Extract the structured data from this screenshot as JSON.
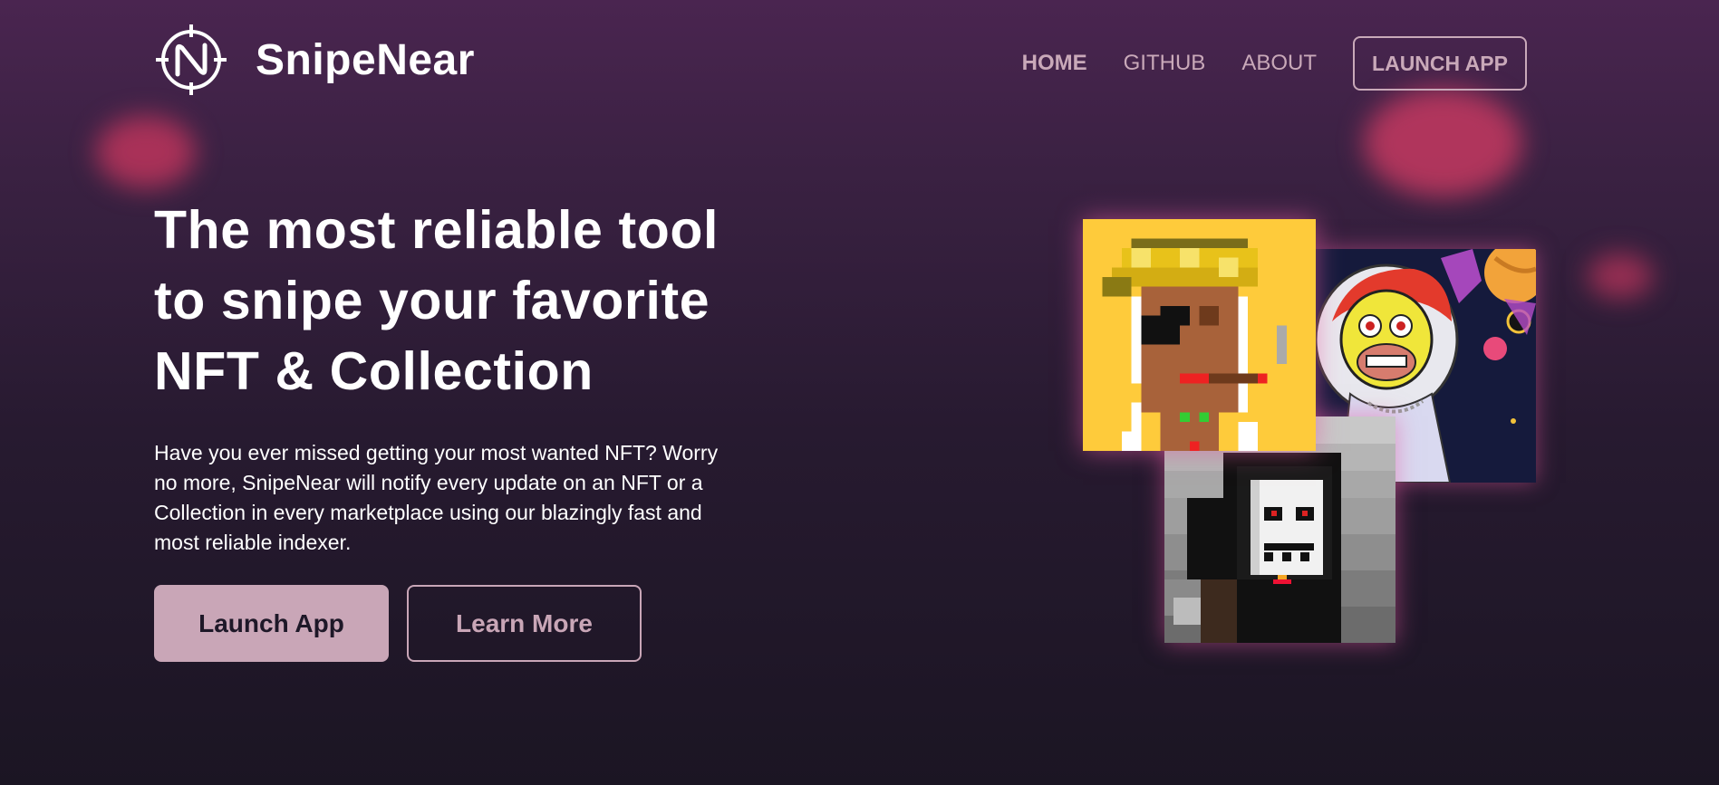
{
  "brand": {
    "name": "SnipeNear",
    "logo_icon": "n-crosshair-logo-icon"
  },
  "nav": {
    "items": [
      {
        "label": "HOME",
        "active": true
      },
      {
        "label": "GITHUB",
        "active": false
      },
      {
        "label": "ABOUT",
        "active": false
      }
    ],
    "cta_label": "LAUNCH APP"
  },
  "hero": {
    "title_lines": [
      "The most reliable tool",
      "to snipe your favorite",
      "NFT & Collection"
    ],
    "description": "Have you ever missed getting your most wanted NFT? Worry no more, SnipeNear will notify every update on an NFT or a Collection in every marketplace using our blazingly fast and most reliable indexer.",
    "primary_button": "Launch App",
    "secondary_button": "Learn More"
  },
  "nft_images": [
    {
      "name": "pixel-punk-nft",
      "background": "#fecb3b"
    },
    {
      "name": "astronaut-ape-nft",
      "background": "#151a3c"
    },
    {
      "name": "pixel-reaper-nft",
      "background": "#9a9a9a"
    }
  ],
  "colors": {
    "accent": "#c9a6b7",
    "nav_text": "#c9a9b9",
    "background_top": "#4a2550",
    "background_bottom": "#1b1523",
    "glow": "#d03c64"
  }
}
